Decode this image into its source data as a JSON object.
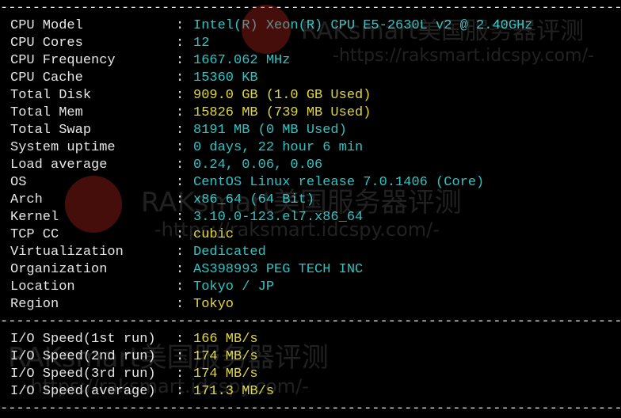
{
  "separator": "------------------------------------------------------------------------------------------",
  "system_info": [
    {
      "label": "CPU Model",
      "value": "Intel(R) Xeon(R) CPU E5-2630L v2 @ 2.40GHz",
      "color": "cyan"
    },
    {
      "label": "CPU Cores",
      "value": "12",
      "color": "cyan"
    },
    {
      "label": "CPU Frequency",
      "value": "1667.062 MHz",
      "color": "cyan"
    },
    {
      "label": "CPU Cache",
      "value": "15360 KB",
      "color": "cyan"
    },
    {
      "label": "Total Disk",
      "value": "909.0 GB (1.0 GB Used)",
      "color": "yellow"
    },
    {
      "label": "Total Mem",
      "value": "15826 MB (739 MB Used)",
      "color": "yellow"
    },
    {
      "label": "Total Swap",
      "value": "8191 MB (0 MB Used)",
      "color": "cyan"
    },
    {
      "label": "System uptime",
      "value": "0 days, 22 hour 6 min",
      "color": "cyan"
    },
    {
      "label": "Load average",
      "value": "0.24, 0.06, 0.06",
      "color": "cyan"
    },
    {
      "label": "OS",
      "value": "CentOS Linux release 7.0.1406 (Core)",
      "color": "cyan"
    },
    {
      "label": "Arch",
      "value": "x86_64 (64 Bit)",
      "color": "cyan"
    },
    {
      "label": "Kernel",
      "value": "3.10.0-123.el7.x86_64",
      "color": "cyan"
    },
    {
      "label": "TCP CC",
      "value": "cubic",
      "color": "yellow"
    },
    {
      "label": "Virtualization",
      "value": "Dedicated",
      "color": "cyan"
    },
    {
      "label": "Organization",
      "value": "AS398993 PEG TECH INC",
      "color": "cyan"
    },
    {
      "label": "Location",
      "value": "Tokyo / JP",
      "color": "cyan"
    },
    {
      "label": "Region",
      "value": "Tokyo",
      "color": "yellow"
    }
  ],
  "io_speed": [
    {
      "label": "I/O Speed(1st run)",
      "value": "166 MB/s",
      "color": "yellow"
    },
    {
      "label": "I/O Speed(2nd run)",
      "value": "174 MB/s",
      "color": "yellow"
    },
    {
      "label": "I/O Speed(3rd run)",
      "value": "174 MB/s",
      "color": "yellow"
    },
    {
      "label": "I/O Speed(average)",
      "value": "171.3 MB/s",
      "color": "yellow"
    }
  ],
  "colon": ":",
  "colors": {
    "background": "#000000",
    "label": "#e6e6e6",
    "cyan": "#2ec4c4",
    "yellow": "#e0d83a"
  },
  "watermark": {
    "brand": "RAKsmart美国服务器评测",
    "url": "-https://raksmart.idcspy.com/-"
  }
}
